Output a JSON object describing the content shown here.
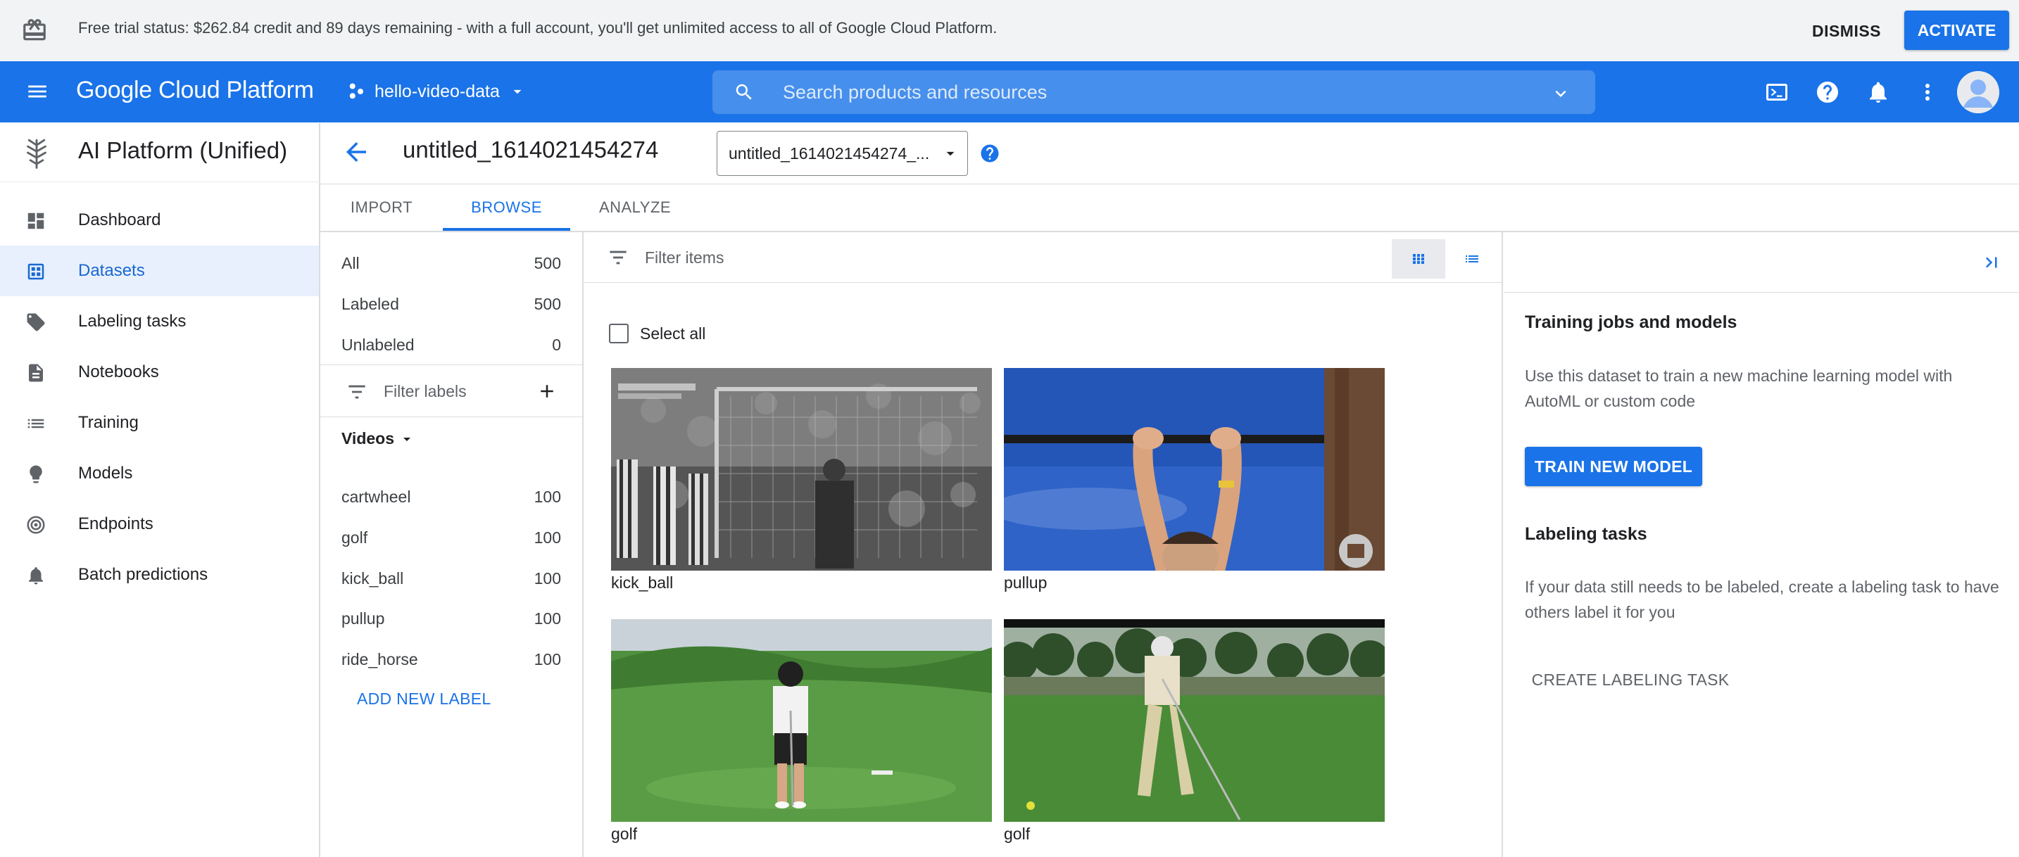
{
  "banner": {
    "message": "Free trial status: $262.84 credit and 89 days remaining - with a full account, you'll get unlimited access to all of Google Cloud Platform.",
    "dismiss_label": "DISMISS",
    "activate_label": "ACTIVATE"
  },
  "header": {
    "brand": "Google Cloud Platform",
    "project": "hello-video-data",
    "search_placeholder": "Search products and resources",
    "icons": [
      "cloud-shell-icon",
      "help-icon",
      "notifications-icon",
      "more-vert-icon",
      "avatar"
    ]
  },
  "product": {
    "name": "AI Platform (Unified)"
  },
  "nav": [
    {
      "label": "Dashboard",
      "icon": "dashboard-icon"
    },
    {
      "label": "Datasets",
      "icon": "datasets-icon",
      "active": true
    },
    {
      "label": "Labeling tasks",
      "icon": "label-tag-icon"
    },
    {
      "label": "Notebooks",
      "icon": "notebook-icon"
    },
    {
      "label": "Training",
      "icon": "training-list-icon"
    },
    {
      "label": "Models",
      "icon": "lightbulb-icon"
    },
    {
      "label": "Endpoints",
      "icon": "endpoint-icon"
    },
    {
      "label": "Batch predictions",
      "icon": "bell-icon"
    }
  ],
  "page": {
    "title": "untitled_1614021454274",
    "dataset_select": "untitled_1614021454274_...",
    "tabs": [
      "IMPORT",
      "BROWSE",
      "ANALYZE"
    ],
    "active_tab": "BROWSE"
  },
  "filters": {
    "counts": [
      {
        "label": "All",
        "count": "500"
      },
      {
        "label": "Labeled",
        "count": "500"
      },
      {
        "label": "Unlabeled",
        "count": "0"
      }
    ],
    "filter_labels_placeholder": "Filter labels",
    "group_label": "Videos",
    "labels": [
      {
        "label": "cartwheel",
        "count": "100"
      },
      {
        "label": "golf",
        "count": "100"
      },
      {
        "label": "kick_ball",
        "count": "100"
      },
      {
        "label": "pullup",
        "count": "100"
      },
      {
        "label": "ride_horse",
        "count": "100"
      }
    ],
    "add_label": "ADD NEW LABEL"
  },
  "items": {
    "filter_placeholder": "Filter items",
    "select_all": "Select all",
    "videos": [
      {
        "label": "kick_ball"
      },
      {
        "label": "pullup"
      },
      {
        "label": "golf"
      },
      {
        "label": "golf"
      }
    ]
  },
  "right_panel": {
    "training_heading": "Training jobs and models",
    "training_text": "Use this dataset to train a new machine learning model with AutoML or custom code",
    "train_button": "TRAIN NEW MODEL",
    "labeling_heading": "Labeling tasks",
    "labeling_text": "If your data still needs to be labeled, create a labeling task to have others label it for you",
    "labeling_button": "CREATE LABELING TASK"
  },
  "colors": {
    "brand_blue": "#1a73e8",
    "active_nav_bg": "#e8f0fe",
    "banner_bg": "#f1f3f4"
  }
}
